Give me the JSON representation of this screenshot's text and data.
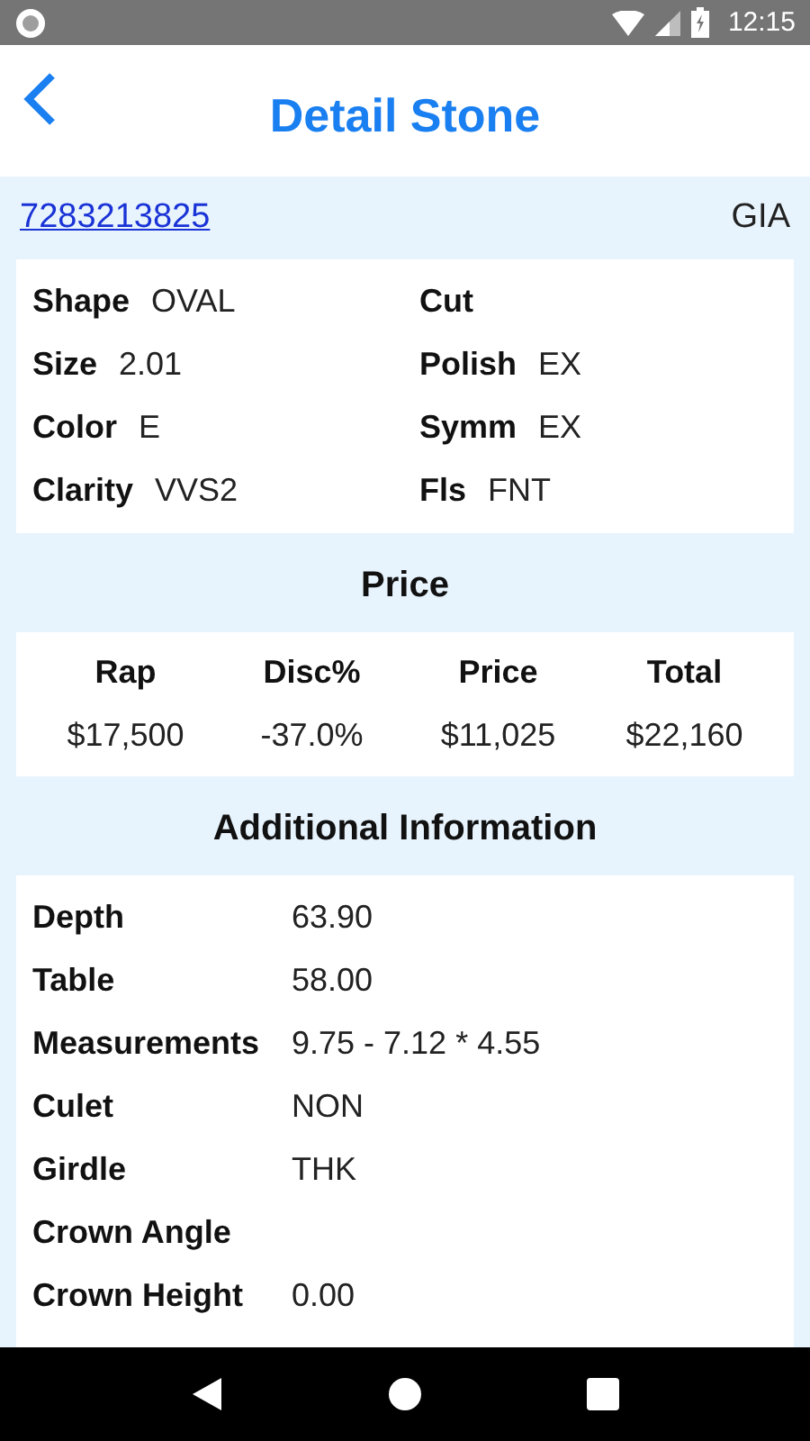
{
  "status_bar": {
    "time": "12:15"
  },
  "header": {
    "title": "Detail Stone"
  },
  "stone": {
    "id": "7283213825",
    "lab": "GIA"
  },
  "specs": [
    {
      "label": "Shape",
      "value": "OVAL"
    },
    {
      "label": "Cut"
    },
    {
      "label": "Size",
      "value": "2.01"
    },
    {
      "label": "Polish",
      "value": "EX"
    },
    {
      "label": "Color",
      "value": "E"
    },
    {
      "label": "Symm",
      "value": "EX"
    },
    {
      "label": "Clarity",
      "value": "VVS2"
    },
    {
      "label": "Fls",
      "value": "FNT"
    }
  ],
  "price": {
    "heading": "Price",
    "columns": [
      {
        "label": "Rap",
        "value": "$17,500"
      },
      {
        "label": "Disc%",
        "value": "-37.0%"
      },
      {
        "label": "Price",
        "value": "$11,025"
      },
      {
        "label": "Total",
        "value": "$22,160"
      }
    ]
  },
  "additional": {
    "heading": "Additional Information",
    "rows": [
      {
        "label": "Depth",
        "value": "63.90"
      },
      {
        "label": "Table",
        "value": "58.00"
      },
      {
        "label": "Measurements",
        "value": "9.75 - 7.12 * 4.55"
      },
      {
        "label": "Culet",
        "value": "NON"
      },
      {
        "label": "Girdle",
        "value": "THK"
      },
      {
        "label": "Crown Angle"
      },
      {
        "label": "Crown Height",
        "value": "0.00"
      }
    ]
  }
}
